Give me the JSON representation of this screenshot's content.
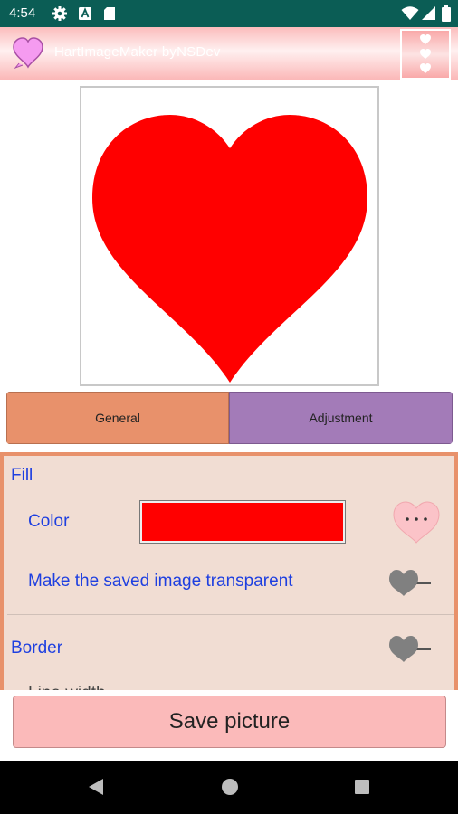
{
  "status_bar": {
    "time": "4:54",
    "left_icons": [
      "gear-icon",
      "a-icon",
      "sd-card-icon"
    ],
    "right_icons": [
      "wifi-icon",
      "signal-icon",
      "battery-icon"
    ]
  },
  "app_bar": {
    "title": "HartImageMaker byNSDev",
    "logo_icon": "heart-logo-icon",
    "menu_icon": "three-hearts-menu-icon"
  },
  "canvas": {
    "shape": "heart",
    "fill_color": "#ff0000",
    "background": "#ffffff"
  },
  "tabs": [
    {
      "label": "General",
      "color": "#e8916b",
      "selected": true
    },
    {
      "label": "Adjustment",
      "color": "#a37bb8",
      "selected": false
    }
  ],
  "settings": {
    "fill_section": "Fill",
    "color_label": "Color",
    "color_value": "#ff0000",
    "more_icon": "heart-more-icon",
    "transparent_label": "Make the saved image transparent",
    "transparent_enabled": false,
    "border_section": "Border",
    "border_enabled": false,
    "line_width_label": "Line width"
  },
  "save_button": "Save picture",
  "nav_bar": {
    "icons": [
      "back-icon",
      "home-icon",
      "recents-icon"
    ]
  }
}
